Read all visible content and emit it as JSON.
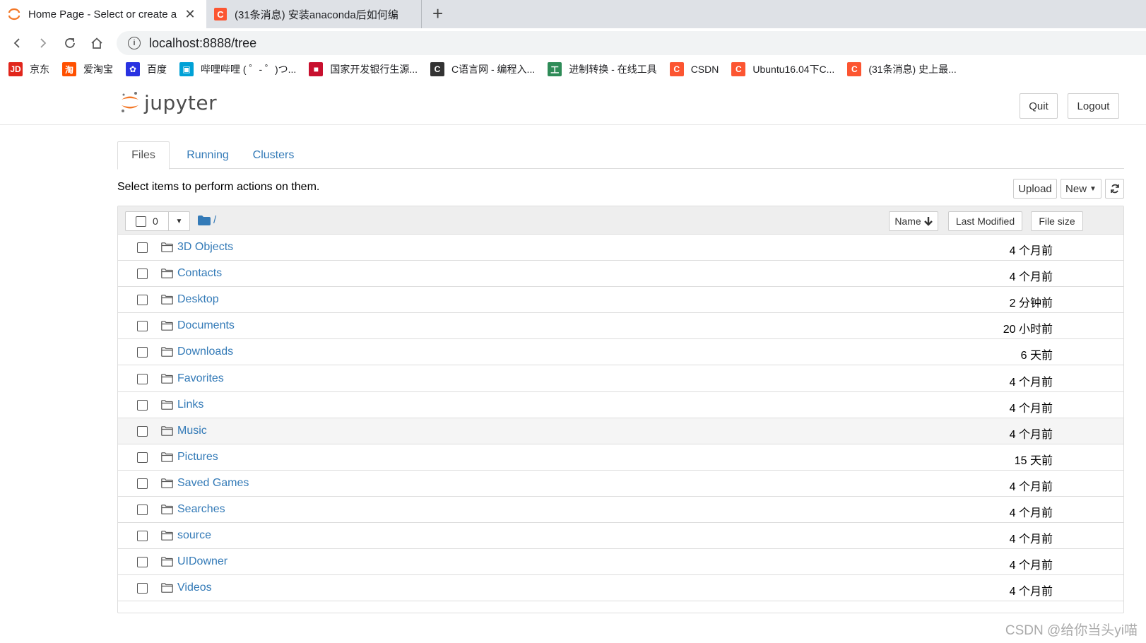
{
  "browser": {
    "tabs": [
      {
        "title": "Home Page - Select or create a",
        "active": true,
        "close": "✕"
      },
      {
        "title": "(31条消息) 安装anaconda后如何编",
        "active": false
      }
    ],
    "newtab": "+",
    "url": "localhost:8888/tree",
    "bookmarks": [
      {
        "label": "京东",
        "icon": "JD",
        "color": "#e1251b"
      },
      {
        "label": "爱淘宝",
        "icon": "淘",
        "color": "#ff5000"
      },
      {
        "label": "百度",
        "icon": "✿",
        "color": "#2932e1"
      },
      {
        "label": "哔哩哔哩 ( ゜- ゜)つ...",
        "icon": "▣",
        "color": "#00a1d6"
      },
      {
        "label": "国家开发银行生源...",
        "icon": "■",
        "color": "#c8102e"
      },
      {
        "label": "C语言网 - 编程入...",
        "icon": "C",
        "color": "#333333"
      },
      {
        "label": "进制转换 - 在线工具",
        "icon": "工",
        "color": "#2e8b57"
      },
      {
        "label": "CSDN",
        "icon": "C",
        "color": "#fc5531"
      },
      {
        "label": "Ubuntu16.04下C...",
        "icon": "C",
        "color": "#fc5531"
      },
      {
        "label": "(31条消息) 史上最...",
        "icon": "C",
        "color": "#fc5531"
      }
    ]
  },
  "header": {
    "logo_text": "jupyter",
    "quit": "Quit",
    "logout": "Logout"
  },
  "tabs": {
    "files": "Files",
    "running": "Running",
    "clusters": "Clusters"
  },
  "toolbar": {
    "hint": "Select items to perform actions on them.",
    "upload": "Upload",
    "new": "New"
  },
  "list": {
    "selected_count": "0",
    "breadcrumb": "/",
    "sort_name": "Name",
    "sort_modified": "Last Modified",
    "sort_size": "File size",
    "rows": [
      {
        "name": "3D Objects",
        "modified": "4 个月前"
      },
      {
        "name": "Contacts",
        "modified": "4 个月前"
      },
      {
        "name": "Desktop",
        "modified": "2 分钟前"
      },
      {
        "name": "Documents",
        "modified": "20 小时前"
      },
      {
        "name": "Downloads",
        "modified": "6 天前"
      },
      {
        "name": "Favorites",
        "modified": "4 个月前"
      },
      {
        "name": "Links",
        "modified": "4 个月前"
      },
      {
        "name": "Music",
        "modified": "4 个月前"
      },
      {
        "name": "Pictures",
        "modified": "15 天前"
      },
      {
        "name": "Saved Games",
        "modified": "4 个月前"
      },
      {
        "name": "Searches",
        "modified": "4 个月前"
      },
      {
        "name": "source",
        "modified": "4 个月前"
      },
      {
        "name": "UIDowner",
        "modified": "4 个月前"
      },
      {
        "name": "Videos",
        "modified": "4 个月前"
      }
    ]
  },
  "watermark": "CSDN @给你当头yi喵"
}
